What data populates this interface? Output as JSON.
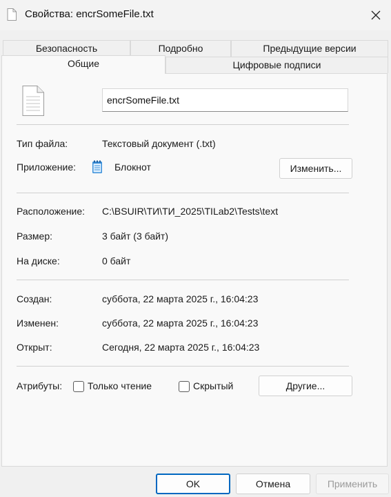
{
  "window": {
    "title": "Свойства: encrSomeFile.txt",
    "close_icon": "close-icon"
  },
  "tabs_back": [
    {
      "label": "Безопасность"
    },
    {
      "label": "Подробно"
    },
    {
      "label": "Предыдущие версии"
    }
  ],
  "tabs_front": [
    {
      "label": "Общие",
      "active": true
    },
    {
      "label": "Цифровые подписи",
      "active": false
    }
  ],
  "general": {
    "file_name": "encrSomeFile.txt",
    "file_type_label": "Тип файла:",
    "file_type_value": "Текстовый документ (.txt)",
    "app_label": "Приложение:",
    "app_value": "Блокнот",
    "change_button": "Изменить...",
    "location_label": "Расположение:",
    "location_value": "C:\\BSUIR\\ТИ\\ТИ_2025\\TILab2\\Tests\\text",
    "size_label": "Размер:",
    "size_value": "3 байт (3 байт)",
    "disk_label": "На диске:",
    "disk_value": "0 байт",
    "created_label": "Создан:",
    "created_value": "суббота, 22 марта 2025 г., 16:04:23",
    "modified_label": "Изменен:",
    "modified_value": "суббота, 22 марта 2025 г., 16:04:23",
    "accessed_label": "Открыт:",
    "accessed_value": "Сегодня, 22 марта 2025 г., 16:04:23",
    "attributes_label": "Атрибуты:",
    "readonly_label": "Только чтение",
    "readonly_checked": false,
    "hidden_label": "Скрытый",
    "hidden_checked": false,
    "other_button": "Другие..."
  },
  "footer": {
    "ok": "OK",
    "cancel": "Отмена",
    "apply": "Применить"
  },
  "colors": {
    "accent": "#0067c0",
    "notepad_icon": "#3a8fd9"
  }
}
